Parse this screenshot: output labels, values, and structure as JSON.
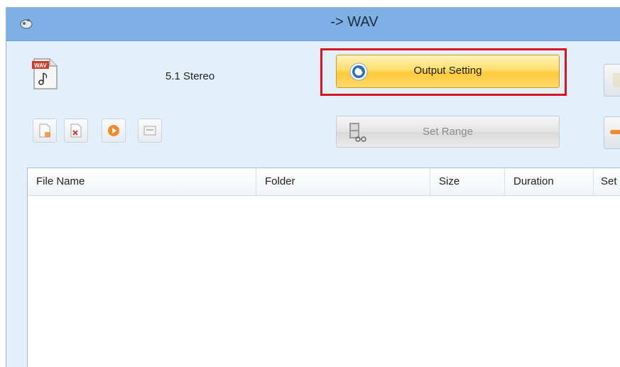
{
  "window": {
    "title": "-> WAV",
    "title_icon": "app-icon"
  },
  "header": {
    "file_type_icon": "wav-file-icon",
    "channel_label": "5.1 Stereo"
  },
  "buttons": {
    "output_setting": {
      "label": "Output Setting",
      "icon": "gear-icon"
    },
    "set_range": {
      "label": "Set Range",
      "icon": "film-scissors-icon",
      "enabled": false
    }
  },
  "toolbar": {
    "items": [
      {
        "icon": "add-file-icon"
      },
      {
        "icon": "remove-file-icon"
      },
      {
        "icon": "play-icon"
      },
      {
        "icon": "info-icon"
      }
    ]
  },
  "file_list": {
    "columns": [
      "File Name",
      "Folder",
      "Size",
      "Duration",
      "Set"
    ],
    "rows": []
  },
  "colors": {
    "titlebar": "#7eb0e6",
    "highlight_border": "#d8141e",
    "output_button": "#fcc93a",
    "accent_orange": "#f08a2a"
  }
}
